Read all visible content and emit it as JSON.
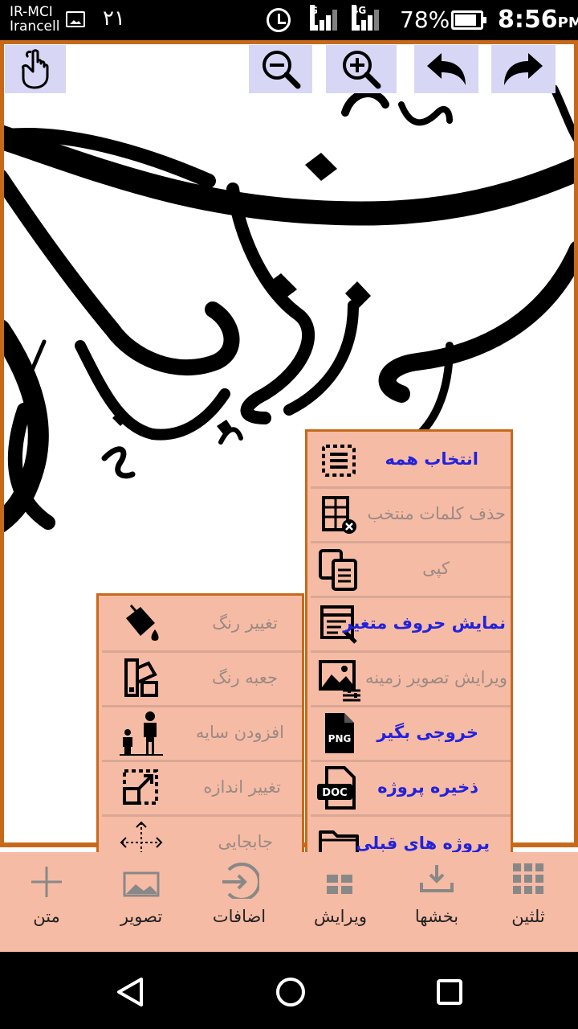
{
  "status_bar": {
    "carrier_line1": "IR-MCI",
    "carrier_line2": "Irancell",
    "date": "۲۱",
    "network1": "G",
    "network2": "4G",
    "battery": "78%",
    "time": "8:56",
    "ampm": "PM"
  },
  "toolbar": {
    "hand_icon": "hand-pointer-icon",
    "zoom_out_icon": "zoom-out-icon",
    "zoom_in_icon": "zoom-in-icon",
    "undo_icon": "undo-icon",
    "redo_icon": "redo-icon",
    "button_bg": "#d7d7f5"
  },
  "main_menu": {
    "items": [
      {
        "label": "انتخاب همه",
        "icon": "select-all-icon",
        "enabled": true
      },
      {
        "label": "حذف کلمات منتخب",
        "icon": "delete-table-icon",
        "enabled": false
      },
      {
        "label": "کپی",
        "icon": "copy-icon",
        "enabled": false
      },
      {
        "label": "نمایش حروف متغیر",
        "icon": "show-variable-letters-icon",
        "enabled": true
      },
      {
        "label": "ویرایش تصویر زمینه",
        "icon": "edit-background-image-icon",
        "enabled": false
      },
      {
        "label": "خروجی بگیر",
        "icon": "png-export-icon",
        "enabled": true
      },
      {
        "label": "ذخیره پروژه",
        "icon": "doc-save-icon",
        "enabled": true
      },
      {
        "label": "پروژه های قبلی",
        "icon": "folder-icon",
        "enabled": true
      }
    ]
  },
  "edit_menu": {
    "items": [
      {
        "label": "تغییر رنگ",
        "icon": "paint-bucket-icon",
        "enabled": false
      },
      {
        "label": "جعبه رنگ",
        "icon": "color-box-icon",
        "enabled": false
      },
      {
        "label": "افزودن سایه",
        "icon": "add-shadow-icon",
        "enabled": false
      },
      {
        "label": "تغییر اندازه",
        "icon": "resize-icon",
        "enabled": false
      },
      {
        "label": "جابجایی",
        "icon": "move-icon",
        "enabled": false
      }
    ]
  },
  "bottom_bar": {
    "items": [
      {
        "label": "ثلثین",
        "icon": "grid-icon"
      },
      {
        "label": "بخشها",
        "icon": "sections-icon"
      },
      {
        "label": "ویرایش",
        "icon": "edit-icon"
      },
      {
        "label": "اضافات",
        "icon": "additions-icon"
      },
      {
        "label": "تصویر",
        "icon": "image-icon"
      },
      {
        "label": "متن",
        "icon": "plus-icon"
      }
    ]
  },
  "colors": {
    "accent_border": "#c8691a",
    "menu_bg": "#f6bba4",
    "enabled_text": "#2222dd",
    "disabled_text": "#9a8a86"
  }
}
